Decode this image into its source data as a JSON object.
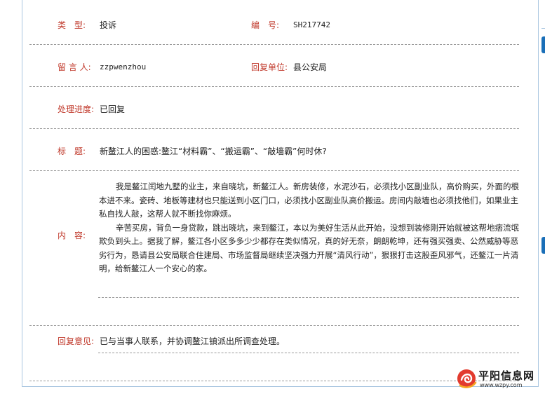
{
  "fields": {
    "type_label": "类　型:",
    "type_value": "投诉",
    "number_label": "编　号:",
    "number_value": "SH217742",
    "poster_label": "留 言 人:",
    "poster_value": "zzpwenzhou",
    "reply_unit_label": "回复单位:",
    "reply_unit_value": "县公安局",
    "progress_label": "处理进度:",
    "progress_value": "已回复",
    "title_label": "标　题:",
    "title_value": "新鳌江人的困惑:鳌江“材料霸”、“搬运霸”、“敲墙霸”何时休?",
    "content_label": "内　容:",
    "content_paragraphs": [
      "我是鳌江闰地九墅的业主，来自晓坑，新鳌江人。新房装修，水泥沙石，必须找小区副业队，高价购买，外面的根本进不来。瓷砖、地板等建材也只能送到小区门口，必须找小区副业队高价搬运。房间内敲墙也必须找他们，如果业主私自找人敲，这帮人就不断找你麻烦。",
      "辛苦买房，背负一身贷款，跳出晓坑，来到鳌江，本以为美好生活从此开始，没想到装修刚开始就被这帮地痞流氓欺负到头上。据我了解，鳌江各小区多多少少都存在类似情况，真的好无奈，朗朗乾坤，还有强买强卖、公然威胁等恶劣行为，恳请县公安局联合住建局、市场监督局继续坚决强力开展“清风行动”，狠狠打击这股歪风邪气，还鳌江一片清明，给新鳌江人一个安心的家。"
    ],
    "reply_label": "回复意见:",
    "reply_value": "已与当事人联系，并协调鳌江镇派出所调查处理。"
  },
  "logo": {
    "name": "平阳信息网",
    "url": "www.wzpy.com",
    "icon": "sun-swirl-logo-icon"
  },
  "colors": {
    "label_red": "#c0392b",
    "border_blue": "#a9c6e0",
    "tab_blue": "#1a6fb8"
  }
}
